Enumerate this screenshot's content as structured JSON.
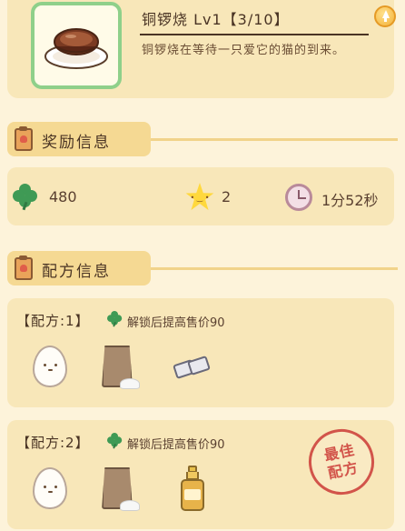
{
  "item": {
    "title": "铜锣烧 Lv1【3/10】",
    "description": "铜锣烧在等待一只爱它的猫的到来。",
    "icon": "dorayaki-icon"
  },
  "reward_section": {
    "title": "奖励信息"
  },
  "rewards": {
    "clover_count": "480",
    "star_count": "2",
    "time": "1分52秒"
  },
  "recipe_section": {
    "title": "配方信息"
  },
  "recipes": [
    {
      "label": "【配方:1】",
      "hint": "解锁后提高售价90",
      "ingredients": [
        "egg-icon",
        "flour-bag-icon",
        "salt-blocks-icon"
      ]
    },
    {
      "label": "【配方:2】",
      "hint": "解锁后提高售价90",
      "ingredients": [
        "egg-icon",
        "flour-bag-icon",
        "oil-bottle-icon"
      ]
    }
  ],
  "stamp": {
    "text": "最佳配方"
  },
  "colors": {
    "background": "#fdf3da",
    "card": "#f8e7b9",
    "section_tab": "#f5d993",
    "clover": "#3f9a55",
    "stamp": "#d2544a"
  }
}
